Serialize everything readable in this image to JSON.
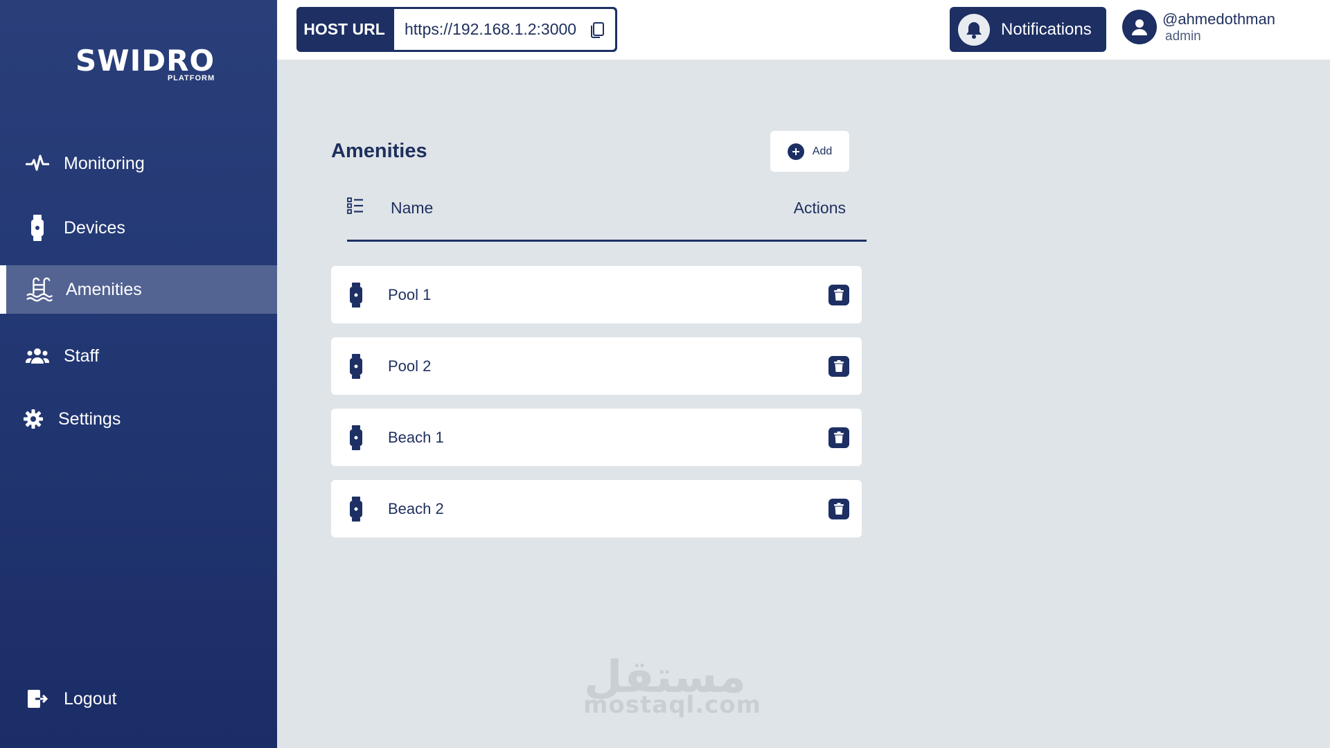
{
  "brand": {
    "name": "SWIDRO",
    "subtitle": "PLATFORM"
  },
  "sidebar": {
    "items": [
      {
        "label": "Monitoring",
        "icon": "pulse-icon"
      },
      {
        "label": "Devices",
        "icon": "device-icon"
      },
      {
        "label": "Amenities",
        "icon": "pool-icon",
        "active": true
      },
      {
        "label": "Staff",
        "icon": "users-icon"
      },
      {
        "label": "Settings",
        "icon": "gear-icon"
      }
    ],
    "logout_label": "Logout"
  },
  "topbar": {
    "host_label": "HOST URL",
    "host_value": "https://192.168.1.2:3000",
    "notifications_label": "Notifications",
    "user_name": "@ahmedothman",
    "user_role": "admin"
  },
  "main": {
    "title": "Amenities",
    "add_label": "Add",
    "table": {
      "columns": [
        "Name",
        "Actions"
      ],
      "rows": [
        {
          "name": "Pool 1"
        },
        {
          "name": "Pool 2"
        },
        {
          "name": "Beach 1"
        },
        {
          "name": "Beach 2"
        }
      ]
    }
  },
  "watermark": {
    "arabic": "مستقل",
    "latin": "mostaql.com"
  },
  "colors": {
    "sidebar": "#233874",
    "accent": "#1d2f63",
    "background": "#dfe4e8"
  }
}
